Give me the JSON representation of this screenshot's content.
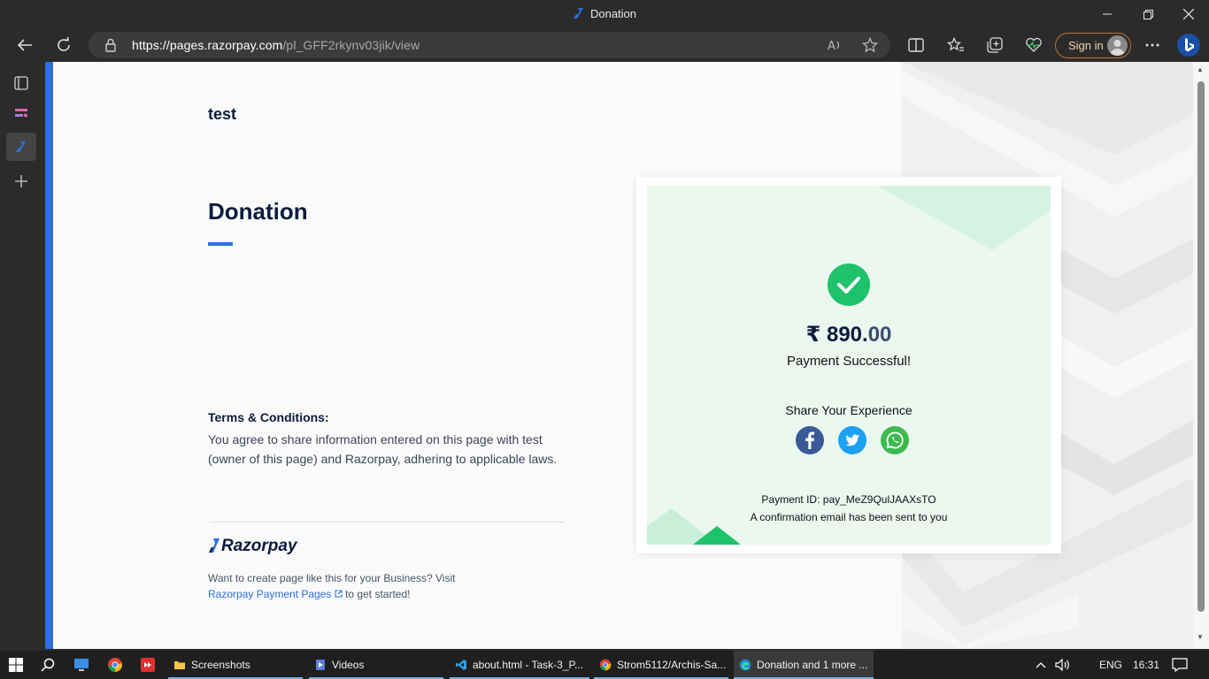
{
  "window": {
    "title": "Donation"
  },
  "browser": {
    "url_host": "https://pages.razorpay.com",
    "url_path": "/pl_GFF2rkynv03jik/view",
    "signin_label": "Sign in"
  },
  "page": {
    "merchant_name": "test",
    "title": "Donation",
    "terms_heading": "Terms & Conditions:",
    "terms_text": "You agree to share information entered on this page with test (owner of this page) and Razorpay, adhering to applicable laws.",
    "brand_name": "Razorpay",
    "promo_text": "Want to create page like this for your Business? Visit",
    "promo_link": "Razorpay Payment Pages",
    "promo_suffix": "to get started!"
  },
  "receipt": {
    "amount_main": "₹ 890.",
    "amount_decimal": "00",
    "status": "Payment Successful!",
    "share_label": "Share Your Experience",
    "payment_id": "Payment ID: pay_MeZ9QulJAAXsTO",
    "confirmation": "A confirmation email has been sent to you"
  },
  "taskbar": {
    "apps": [
      {
        "label": "Screenshots"
      },
      {
        "label": "Videos"
      },
      {
        "label": "about.html - Task-3_P..."
      },
      {
        "label": "Strom5112/Archis-Sa..."
      },
      {
        "label": "Donation and 1 more ..."
      }
    ],
    "language": "ENG",
    "time": "16:31"
  },
  "colors": {
    "accent": "#2b6fe0",
    "success": "#1ec26a",
    "navy": "#0d1b3e"
  }
}
